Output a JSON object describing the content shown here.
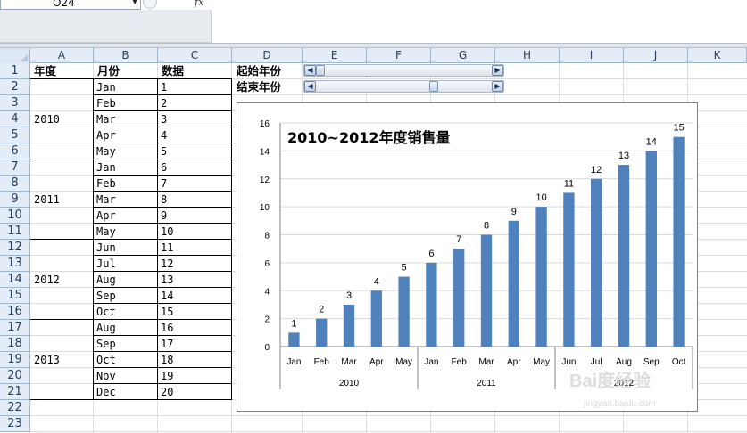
{
  "formula_bar": {
    "name_box": "O24",
    "fx_label": "fx"
  },
  "columns": [
    "A",
    "B",
    "C",
    "D",
    "E",
    "F",
    "G",
    "H",
    "I",
    "J",
    "K"
  ],
  "rows": [
    "1",
    "2",
    "3",
    "4",
    "5",
    "6",
    "7",
    "8",
    "9",
    "10",
    "11",
    "12",
    "13",
    "14",
    "15",
    "16",
    "17",
    "18",
    "19",
    "20",
    "21",
    "22",
    "23"
  ],
  "headers": {
    "year": "年度",
    "month": "月份",
    "data": "数据"
  },
  "year_groups": [
    "2010",
    "2011",
    "2012",
    "2013"
  ],
  "month_rows": [
    {
      "month": "Jan",
      "value": "1"
    },
    {
      "month": "Feb",
      "value": "2"
    },
    {
      "month": "Mar",
      "value": "3"
    },
    {
      "month": "Apr",
      "value": "4"
    },
    {
      "month": "May",
      "value": "5"
    },
    {
      "month": "Jan",
      "value": "6"
    },
    {
      "month": "Feb",
      "value": "7"
    },
    {
      "month": "Mar",
      "value": "8"
    },
    {
      "month": "Apr",
      "value": "9"
    },
    {
      "month": "May",
      "value": "10"
    },
    {
      "month": "Jun",
      "value": "11"
    },
    {
      "month": "Jul",
      "value": "12"
    },
    {
      "month": "Aug",
      "value": "13"
    },
    {
      "month": "Sep",
      "value": "14"
    },
    {
      "month": "Oct",
      "value": "15"
    },
    {
      "month": "Aug",
      "value": "16"
    },
    {
      "month": "Sep",
      "value": "17"
    },
    {
      "month": "Oct",
      "value": "18"
    },
    {
      "month": "Nov",
      "value": "19"
    },
    {
      "month": "Dec",
      "value": "20"
    }
  ],
  "controls": {
    "start_label": "起始年份",
    "end_label": "结束年份",
    "start_scroll_position": 0.0,
    "end_scroll_position": 0.67
  },
  "colors": {
    "bar": "#4f81bd",
    "grid": "#d9d9d9",
    "header_bg": "#e4ecf7"
  },
  "chart_data": {
    "type": "bar",
    "title": "2010~2012年度销售量",
    "categories": [
      "Jan",
      "Feb",
      "Mar",
      "Apr",
      "May",
      "Jan",
      "Feb",
      "Mar",
      "Apr",
      "May",
      "Jun",
      "Jul",
      "Aug",
      "Sep",
      "Oct"
    ],
    "groups": [
      {
        "label": "2010",
        "count": 5
      },
      {
        "label": "2011",
        "count": 5
      },
      {
        "label": "2012",
        "count": 5
      }
    ],
    "values": [
      1,
      2,
      3,
      4,
      5,
      6,
      7,
      8,
      9,
      10,
      11,
      12,
      13,
      14,
      15
    ],
    "yticks": [
      "0",
      "2",
      "4",
      "6",
      "8",
      "10",
      "12",
      "14",
      "16"
    ],
    "ylim": [
      0,
      16
    ],
    "grid": true,
    "legend": "none"
  },
  "watermark": "Bai度经验 jingyan.baidu.com"
}
